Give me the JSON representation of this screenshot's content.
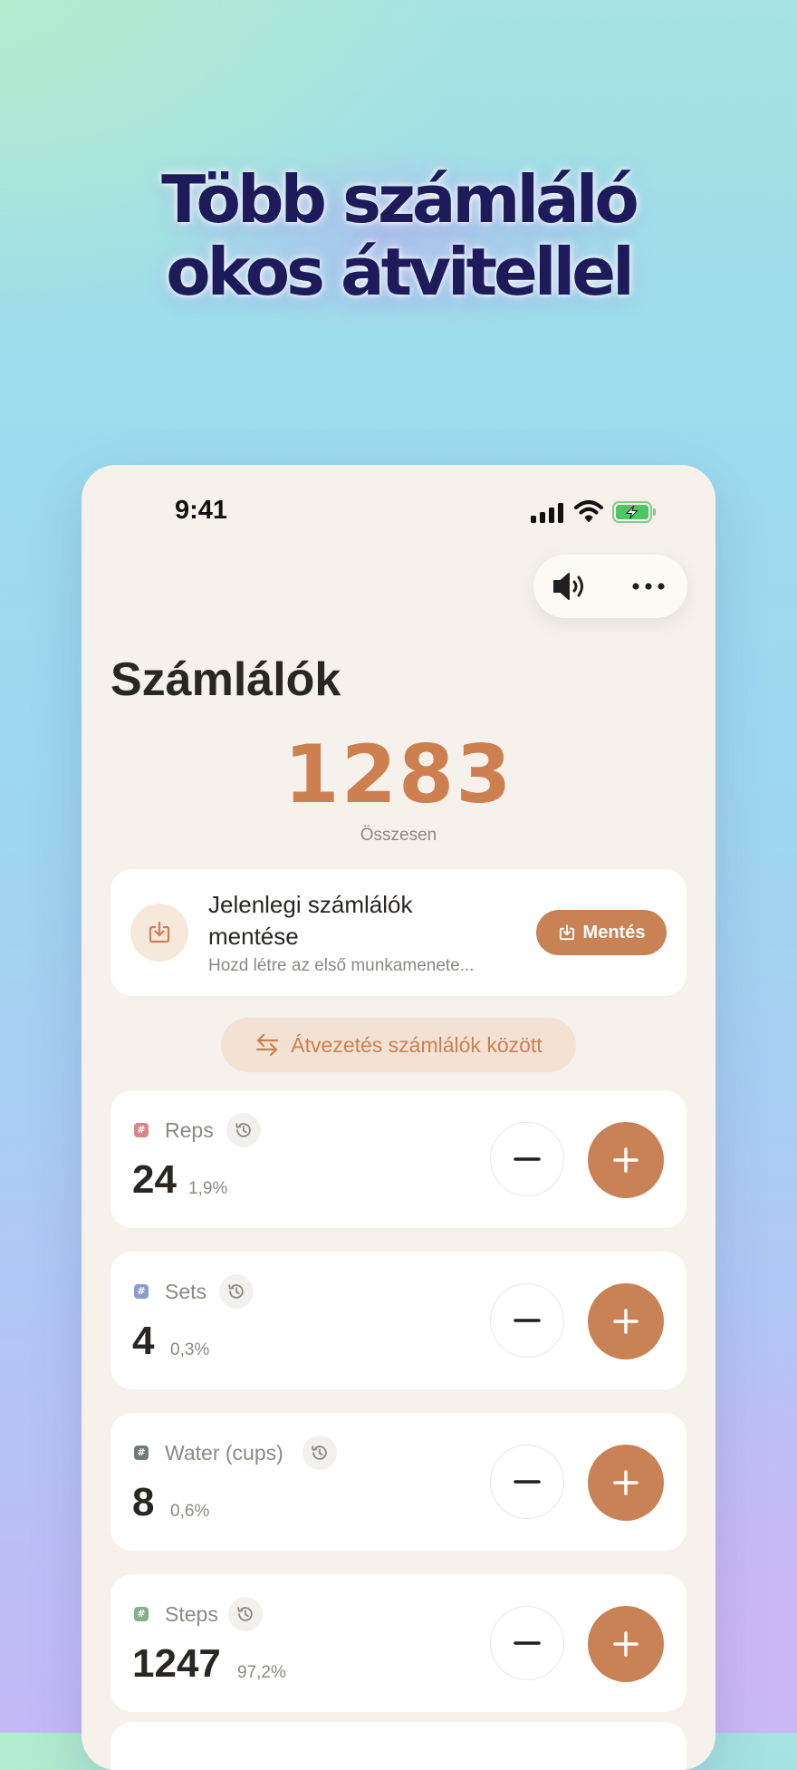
{
  "hero": {
    "title_line1": "Több számláló",
    "title_line2": "okos átvitellel"
  },
  "status_bar": {
    "time": "9:41"
  },
  "page": {
    "title": "Számlálók",
    "total_value": "1283",
    "total_label": "Összesen"
  },
  "save_card": {
    "title": "Jelenlegi számlálók mentése",
    "subtitle": "Hozd létre az első munkamenete...",
    "button_label": "Mentés"
  },
  "transfer": {
    "label": "Átvezetés számlálók között"
  },
  "counters": [
    {
      "name": "Reps",
      "value": "24",
      "percent": "1,9%",
      "tag_color": "#d9858a"
    },
    {
      "name": "Sets",
      "value": "4",
      "percent": "0,3%",
      "tag_color": "#8a9ccd"
    },
    {
      "name": "Water (cups)",
      "value": "8",
      "percent": "0,6%",
      "tag_color": "#6f7b75"
    },
    {
      "name": "Steps",
      "value": "1247",
      "percent": "97,2%",
      "tag_color": "#86b08c"
    }
  ],
  "colors": {
    "accent": "#c98255",
    "total_number": "#cd7f50",
    "title_text": "#1d1b5a",
    "card_bg": "#ffffff",
    "screen_bg": "#f6f1ea"
  },
  "icons": {
    "speaker": "speaker-icon",
    "more": "more-dots-icon",
    "save": "download-tray-icon",
    "transfer": "transfer-arrows-icon",
    "history": "history-clock-icon",
    "minus": "minus-icon",
    "plus": "plus-icon"
  }
}
